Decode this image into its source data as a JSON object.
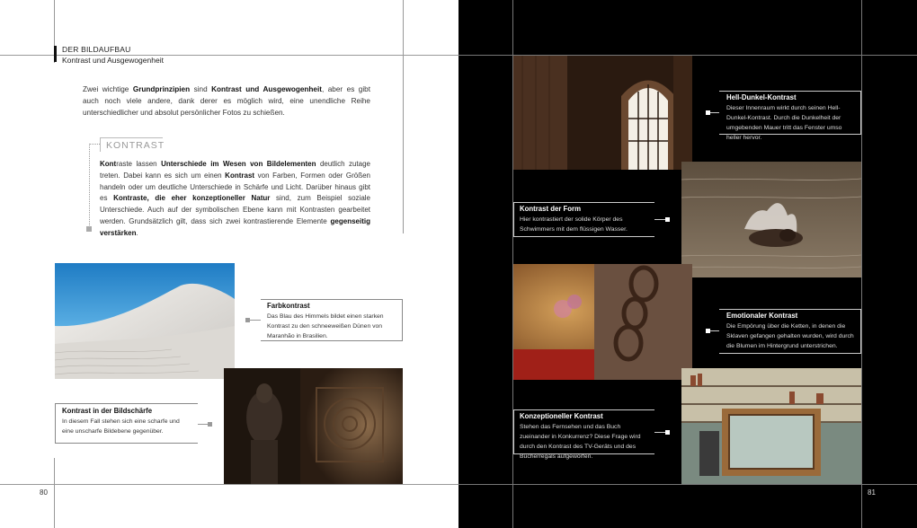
{
  "left_page": {
    "section_label": "DER BILDAUFBAU",
    "section_title": "Kontrast und Ausgewogenheit",
    "intro_html": "Zwei wichtige <b>Grundprinzipien</b> sind <b>Kontrast und Ausgewogenheit</b>, aber es gibt auch noch viele andere, dank derer es möglich wird, eine unendliche Reihe unterschiedlicher und absolut persönlicher Fotos zu schießen.",
    "kontrast_heading": "KONTRAST",
    "kontrast_body_html": "<b>Kont</b>raste lassen <b>Unterschiede im Wesen von Bildelementen</b> deutlich zutage treten. Dabei kann es sich um einen <b>Kontrast</b> von Farben, Formen oder Größen handeln oder um deutliche Unterschiede in Schärfe und Licht. Darüber hinaus gibt es <b>Kontraste, die eher konzeptioneller Natur</b> sind, zum Beispiel soziale Unterschiede. Auch auf der symbolischen Ebene kann mit Kontrasten gearbeitet werden. Grundsätzlich gilt, dass sich zwei kontrastierende Elemente <b>gegenseitig verstärken</b>.",
    "page_number": "80",
    "captions": {
      "farbkontrast": {
        "title": "Farbkontrast",
        "text": "Das Blau des Himmels bildet einen starken Kontrast zu den schneeweißen Dünen von Maranhão in Brasilien."
      },
      "bildschaerfe": {
        "title": "Kontrast in der Bildschärfe",
        "text": "In diesem Fall stehen sich eine scharfe und eine unscharfe Bildebene gegenüber."
      }
    }
  },
  "right_page": {
    "page_number": "81",
    "captions": {
      "helldunkel": {
        "title": "Hell-Dunkel-Kontrast",
        "text": "Dieser Innenraum wirkt durch seinen Hell-Dunkel-Kontrast. Durch die Dunkelheit der umgebenden Mauer tritt das Fenster umso heller hervor."
      },
      "form": {
        "title": "Kontrast der Form",
        "text": "Hier kontrastiert der solide Körper des Schwimmers mit dem flüssigen Wasser."
      },
      "emotional": {
        "title": "Emotionaler Kontrast",
        "text": "Die Empörung über die Ketten, in denen die Sklaven gefangen gehalten wurden, wird durch die Blumen im Hintergrund unterstrichen."
      },
      "konzept": {
        "title": "Konzeptioneller Kontrast",
        "text": "Stehen das Fernsehen und das Buch zueinander in Konkurrenz? Diese Frage wird durch den Kontrast des TV-Geräts und des Bücherregals aufgeworfen."
      }
    }
  }
}
